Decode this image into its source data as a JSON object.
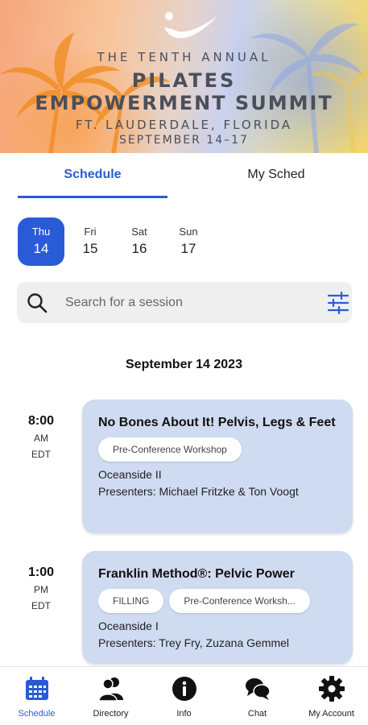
{
  "banner": {
    "line1": "THE TENTH ANNUAL",
    "line2": "PILATES",
    "line3": "EMPOWERMENT SUMMIT",
    "line4": "FT. LAUDERDALE, FLORIDA",
    "line5": "SEPTEMBER 14–17"
  },
  "tabs": [
    {
      "label": "Schedule",
      "active": true
    },
    {
      "label": "My Sched",
      "active": false
    }
  ],
  "days": [
    {
      "name": "Thu",
      "date": "14",
      "active": true
    },
    {
      "name": "Fri",
      "date": "15",
      "active": false
    },
    {
      "name": "Sat",
      "date": "16",
      "active": false
    },
    {
      "name": "Sun",
      "date": "17",
      "active": false
    }
  ],
  "search": {
    "placeholder": "Search for a session"
  },
  "date_heading": "September 14 2023",
  "sessions": [
    {
      "time": "8:00",
      "ampm": "AM",
      "tz": "EDT",
      "title": "No Bones About It! Pelvis, Legs & Feet",
      "chips": [
        "Pre-Conference Workshop"
      ],
      "location": "Oceanside II",
      "presenters": "Presenters: Michael Fritzke & Ton Voogt"
    },
    {
      "time": "1:00",
      "ampm": "PM",
      "tz": "EDT",
      "title": "Franklin Method®: Pelvic Power",
      "chips": [
        "FILLING",
        "Pre-Conference Worksh..."
      ],
      "location": "Oceanside I",
      "presenters": "Presenters: Trey Fry, Zuzana Gemmel"
    }
  ],
  "bottom_nav": [
    {
      "label": "Schedule",
      "icon": "calendar-icon",
      "active": true
    },
    {
      "label": "Directory",
      "icon": "people-icon",
      "active": false
    },
    {
      "label": "Info",
      "icon": "info-icon",
      "active": false
    },
    {
      "label": "Chat",
      "icon": "chat-bubbles-icon",
      "active": false
    },
    {
      "label": "My Account",
      "icon": "gear-icon",
      "active": false
    }
  ],
  "colors": {
    "accent": "#2a5bd7",
    "card": "#cfdbf1",
    "search_bg": "#efefef"
  }
}
